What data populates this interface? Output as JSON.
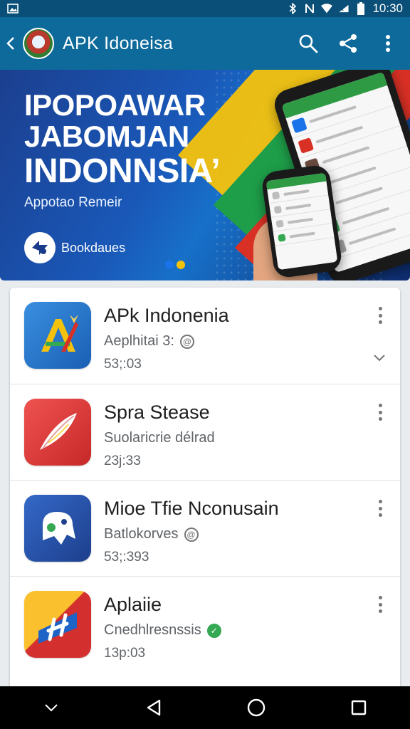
{
  "status_bar": {
    "time": "10:30",
    "icons": [
      "image-icon",
      "bluetooth-icon",
      "nfc-icon",
      "wifi-icon",
      "signal-icon",
      "battery-icon"
    ]
  },
  "app_bar": {
    "title": "APK Idoneisa",
    "actions": [
      "search-icon",
      "share-icon",
      "more-vert-icon"
    ]
  },
  "banner": {
    "headline_1": "IPOPOAWAR",
    "headline_2": "JABOMJAN",
    "headline_3": "INDONNSIA’",
    "subtitle": "Appotao Remeir",
    "badge_label": "Bookdaues",
    "colors": {
      "yellow": "#f4c20d",
      "green": "#1e9e49",
      "red": "#d93025",
      "blue": "#1a58b8"
    }
  },
  "apps": [
    {
      "name": "APk Indonenia",
      "desc": "Aeplhitai 3: @",
      "size": "53;:03",
      "expand": true,
      "badge": "plain",
      "icon_colors": [
        "#2f80d4",
        "#1a5fb4"
      ]
    },
    {
      "name": "Spra Stease",
      "desc": "Suolaricrie délrad",
      "size": "23j:33",
      "expand": false,
      "badge": "none",
      "icon_colors": [
        "#e53935",
        "#c62828"
      ]
    },
    {
      "name": "Mioe Tfie Nconusain",
      "desc": "Batlokorves @",
      "size": "53;:393",
      "expand": false,
      "badge": "plain",
      "icon_colors": [
        "#2c5bb8",
        "#1d3f8c"
      ]
    },
    {
      "name": "Aplaiie",
      "desc": "Cnedhlresnssis",
      "size": "13p:03",
      "expand": false,
      "badge": "green",
      "icon_colors": [
        "#f9a825",
        "#d32f2f"
      ]
    }
  ],
  "nav_bar": {
    "buttons": [
      "chevron-down-icon",
      "back-triangle-icon",
      "home-circle-icon",
      "recents-square-icon"
    ]
  }
}
